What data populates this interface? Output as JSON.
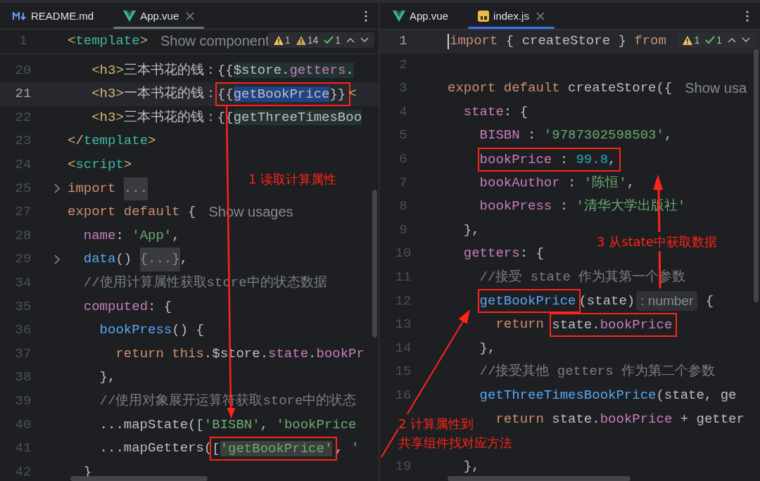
{
  "panes": [
    {
      "focused": false,
      "tabs": [
        {
          "label": "README.md",
          "kind": "markdown",
          "selected": false
        },
        {
          "label": "App.vue",
          "kind": "vue",
          "selected": true
        }
      ],
      "inspections": [
        {
          "kind": "warning",
          "text": "1"
        },
        {
          "kind": "weak_warning",
          "text": "14"
        },
        {
          "kind": "ok",
          "text": "1"
        }
      ],
      "sticky_line": {
        "number": "1",
        "current": false,
        "folded": false,
        "tokens": [
          {
            "kind": "br",
            "text": "<"
          },
          {
            "kind": "tag",
            "text": "template"
          },
          {
            "kind": "br",
            "text": ">"
          },
          {
            "kind": "hint",
            "text": "Show component"
          }
        ]
      },
      "lines": [
        {
          "number": "20",
          "current": false,
          "folded": false,
          "tokens": [
            {
              "kind": "br",
              "text": "   <h3>"
            },
            {
              "kind": "plain",
              "text": "三本书花的钱：{{"
            },
            {
              "kind": "inject",
              "parts": [
                {
                  "kind": "plain",
                  "text": "$store."
                },
                {
                  "kind": "prop",
                  "text": "getters"
                },
                {
                  "kind": "plain",
                  "text": "."
                }
              ]
            }
          ]
        },
        {
          "number": "21",
          "current": true,
          "folded": false,
          "tokens": [
            {
              "kind": "br",
              "text": "   <h3>"
            },
            {
              "kind": "plain",
              "text": "一本书花的钱："
            },
            {
              "kind": "box",
              "parts": [
                {
                  "kind": "plain",
                  "text": "{{"
                },
                {
                  "kind": "selection",
                  "parts": [
                    {
                      "kind": "plain",
                      "text": "getBookPrice"
                    }
                  ]
                },
                {
                  "kind": "plain",
                  "text": "}}"
                }
              ]
            },
            {
              "kind": "br",
              "text": "<"
            }
          ]
        },
        {
          "number": "22",
          "current": false,
          "folded": false,
          "tokens": [
            {
              "kind": "br",
              "text": "   <h3>"
            },
            {
              "kind": "plain",
              "text": "三本书花的钱：{{"
            },
            {
              "kind": "inject",
              "parts": [
                {
                  "kind": "plain",
                  "text": "getThreeTimesBoo"
                }
              ]
            }
          ]
        },
        {
          "number": "23",
          "current": false,
          "folded": false,
          "tokens": [
            {
              "kind": "br",
              "text": "</"
            },
            {
              "kind": "tag",
              "text": "template"
            },
            {
              "kind": "br",
              "text": ">"
            }
          ]
        },
        {
          "number": "24",
          "current": false,
          "folded": false,
          "tokens": [
            {
              "kind": "br",
              "text": "<"
            },
            {
              "kind": "tag",
              "text": "script"
            },
            {
              "kind": "br",
              "text": ">"
            }
          ]
        },
        {
          "number": "25",
          "current": false,
          "folded": true,
          "tokens": [
            {
              "kind": "kw",
              "text": "import "
            },
            {
              "kind": "fold",
              "text": "..."
            }
          ]
        },
        {
          "number": "27",
          "current": false,
          "folded": false,
          "tokens": [
            {
              "kind": "kw",
              "text": "export default"
            },
            {
              "kind": "plain",
              "text": " {"
            },
            {
              "kind": "hint",
              "text": "Show usages"
            }
          ]
        },
        {
          "number": "28",
          "current": false,
          "folded": false,
          "tokens": [
            {
              "kind": "prop",
              "text": "  name"
            },
            {
              "kind": "plain",
              "text": ": "
            },
            {
              "kind": "str",
              "text": "'App'"
            },
            {
              "kind": "plain",
              "text": ","
            }
          ]
        },
        {
          "number": "29",
          "current": false,
          "folded": true,
          "tokens": [
            {
              "kind": "fn",
              "text": "  data"
            },
            {
              "kind": "plain",
              "text": "() "
            },
            {
              "kind": "fold",
              "text": "{...}"
            },
            {
              "kind": "plain",
              "text": ","
            }
          ]
        },
        {
          "number": "34",
          "current": false,
          "folded": false,
          "tokens": [
            {
              "kind": "cmt",
              "text": "  //使用计算属性获取store中的状态数据"
            }
          ]
        },
        {
          "number": "35",
          "current": false,
          "folded": false,
          "tokens": [
            {
              "kind": "prop",
              "text": "  computed"
            },
            {
              "kind": "plain",
              "text": ": {"
            }
          ]
        },
        {
          "number": "36",
          "current": false,
          "folded": false,
          "tokens": [
            {
              "kind": "fn",
              "text": "    bookPress"
            },
            {
              "kind": "plain",
              "text": "() {"
            }
          ]
        },
        {
          "number": "37",
          "current": false,
          "folded": false,
          "tokens": [
            {
              "kind": "kw",
              "text": "      return this"
            },
            {
              "kind": "plain",
              "text": ".$store."
            },
            {
              "kind": "prop",
              "text": "state"
            },
            {
              "kind": "plain",
              "text": "."
            },
            {
              "kind": "prop",
              "text": "bookPr"
            }
          ]
        },
        {
          "number": "38",
          "current": false,
          "folded": false,
          "tokens": [
            {
              "kind": "plain",
              "text": "    },"
            }
          ]
        },
        {
          "number": "39",
          "current": false,
          "folded": false,
          "tokens": [
            {
              "kind": "cmt",
              "text": "    //使用对象展开运算符获取store中的状态"
            }
          ]
        },
        {
          "number": "40",
          "current": false,
          "folded": false,
          "tokens": [
            {
              "kind": "plain",
              "text": "    ...mapState(["
            },
            {
              "kind": "str",
              "text": "'BISBN'"
            },
            {
              "kind": "plain",
              "text": ", "
            },
            {
              "kind": "str",
              "text": "'bookPrice"
            }
          ]
        },
        {
          "number": "41",
          "current": false,
          "folded": false,
          "tokens": [
            {
              "kind": "plain",
              "text": "    ...mapGetters("
            },
            {
              "kind": "box",
              "parts": [
                {
                  "kind": "plain",
                  "text": "["
                },
                {
                  "kind": "match",
                  "parts": [
                    {
                      "kind": "str",
                      "text": "'getBookPrice'"
                    }
                  ]
                }
              ]
            },
            {
              "kind": "plain",
              "text": ", "
            },
            {
              "kind": "str",
              "text": "'"
            }
          ]
        },
        {
          "number": "42",
          "current": false,
          "folded": false,
          "tokens": [
            {
              "kind": "plain",
              "text": "  }"
            }
          ]
        }
      ]
    },
    {
      "focused": true,
      "tabs": [
        {
          "label": "App.vue",
          "kind": "vue",
          "selected": false
        },
        {
          "label": "index.js",
          "kind": "js",
          "selected": true
        }
      ],
      "inspections": [
        {
          "kind": "warning",
          "text": "1"
        },
        {
          "kind": "ok",
          "text": "1"
        }
      ],
      "lines": [
        {
          "number": "1",
          "current": true,
          "tokens": [
            {
              "kind": "kw",
              "text": "import"
            },
            {
              "kind": "plain",
              "text": " { createStore } "
            },
            {
              "kind": "kw",
              "text": "from"
            }
          ]
        },
        {
          "number": "2",
          "current": false
        },
        {
          "number": "3",
          "current": false,
          "tokens": [
            {
              "kind": "kw",
              "text": "export default"
            },
            {
              "kind": "plain",
              "text": " createStore({"
            },
            {
              "kind": "hint",
              "text": "Show usa"
            }
          ]
        },
        {
          "number": "4",
          "current": false,
          "tokens": [
            {
              "kind": "prop",
              "text": "  state"
            },
            {
              "kind": "plain",
              "text": ": {"
            }
          ]
        },
        {
          "number": "5",
          "current": false,
          "tokens": [
            {
              "kind": "prop",
              "text": "    BISBN"
            },
            {
              "kind": "plain",
              "text": " : "
            },
            {
              "kind": "str",
              "text": "'9787302598503'"
            },
            {
              "kind": "plain",
              "text": ","
            }
          ]
        },
        {
          "number": "6",
          "current": false,
          "tokens": [
            {
              "kind": "box",
              "parts": [
                {
                  "kind": "prop",
                  "text": "    bookPrice"
                },
                {
                  "kind": "plain",
                  "text": " : "
                },
                {
                  "kind": "num",
                  "text": "99.8"
                },
                {
                  "kind": "plain",
                  "text": ","
                }
              ]
            }
          ]
        },
        {
          "number": "7",
          "current": false,
          "tokens": [
            {
              "kind": "prop",
              "text": "    bookAuthor"
            },
            {
              "kind": "plain",
              "text": " : "
            },
            {
              "kind": "str",
              "text": "'陈恒'"
            },
            {
              "kind": "plain",
              "text": ","
            }
          ]
        },
        {
          "number": "8",
          "current": false,
          "tokens": [
            {
              "kind": "prop",
              "text": "    bookPress"
            },
            {
              "kind": "plain",
              "text": " : "
            },
            {
              "kind": "str",
              "text": "'清华大学出版社'"
            }
          ]
        },
        {
          "number": "9",
          "current": false,
          "tokens": [
            {
              "kind": "plain",
              "text": "  },"
            }
          ]
        },
        {
          "number": "10",
          "current": false,
          "tokens": [
            {
              "kind": "prop",
              "text": "  getters"
            },
            {
              "kind": "plain",
              "text": ": {"
            }
          ]
        },
        {
          "number": "11",
          "current": false,
          "tokens": [
            {
              "kind": "cmt",
              "text": "    //接受 state 作为其第一个参数"
            }
          ]
        },
        {
          "number": "12",
          "current": false,
          "tokens": [
            {
              "kind": "box",
              "parts": [
                {
                  "kind": "fn",
                  "text": "    getBookPrice"
                }
              ]
            },
            {
              "kind": "plain",
              "text": "(state)"
            },
            {
              "kind": "chip",
              "text": ": number"
            },
            {
              "kind": "plain",
              "text": " {"
            }
          ]
        },
        {
          "number": "13",
          "current": false,
          "tokens": [
            {
              "kind": "kw",
              "text": "      return "
            },
            {
              "kind": "box",
              "parts": [
                {
                  "kind": "plain",
                  "text": "state."
                },
                {
                  "kind": "prop",
                  "text": "bookPrice"
                }
              ]
            }
          ]
        },
        {
          "number": "14",
          "current": false,
          "tokens": [
            {
              "kind": "plain",
              "text": "    },"
            }
          ]
        },
        {
          "number": "15",
          "current": false,
          "tokens": [
            {
              "kind": "cmt",
              "text": "    //接受其他 getters 作为第二个参数"
            }
          ]
        },
        {
          "number": "16",
          "current": false,
          "tokens": [
            {
              "kind": "fn",
              "text": "    getThreeTimesBookPrice"
            },
            {
              "kind": "plain",
              "text": "(state, ge"
            }
          ]
        },
        {
          "current": false,
          "tokens": [
            {
              "kind": "kw",
              "text": "      return"
            },
            {
              "kind": "plain",
              "text": " state."
            },
            {
              "kind": "prop",
              "text": "bookPrice"
            },
            {
              "kind": "plain",
              "text": " + getter"
            }
          ]
        },
        {
          "current": false
        },
        {
          "number": "19",
          "current": false,
          "tokens": [
            {
              "kind": "plain",
              "text": "  },"
            }
          ]
        }
      ]
    }
  ],
  "annotations": [
    {
      "lines": [
        "1 读取计算属性"
      ]
    },
    {
      "lines": [
        "3 从state中获取数据"
      ]
    },
    {
      "lines": [
        "2 计算属性到",
        "共享组件找对应方法"
      ]
    }
  ]
}
